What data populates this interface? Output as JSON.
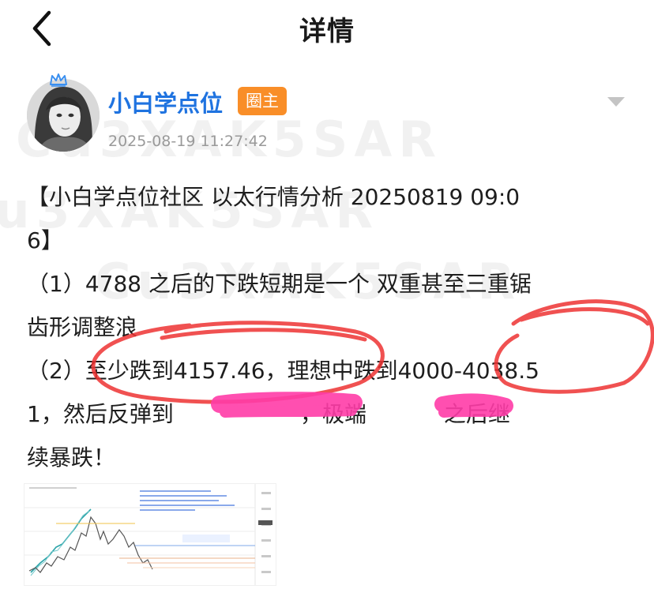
{
  "nav": {
    "title": "详情",
    "back_icon": "chevron-left-icon"
  },
  "author": {
    "name": "小白学点位",
    "badge": "圈主",
    "time": "2025-08-19 11:27:42",
    "badge_color": "#f98e28",
    "name_color": "#1f73e0",
    "crown_color": "#3a8ff0"
  },
  "post": {
    "lines": [
      "【小白学点位社区 以太行情分析 20250819 09:0",
      "6】",
      "（1）4788 之后的下跌短期是一个 双重甚至三重锯",
      "齿形调整浪",
      "（2）至少跌到4157.46，理想中跌到4000-4038.5",
      "1，然后反弹到                  ，极端           之后继",
      "续暴跌！"
    ]
  },
  "annotations": {
    "circle_color": "#ee3333",
    "redact_color": "#ff3ca8"
  },
  "watermark_text": "Cu3XAK5SAR"
}
